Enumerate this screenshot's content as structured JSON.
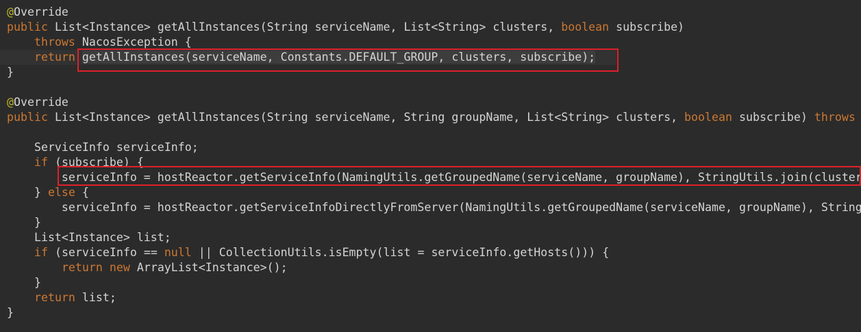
{
  "editor": {
    "lines": [
      {
        "tokens": [
          {
            "cls": "ann",
            "t": "@"
          },
          {
            "cls": "txt",
            "t": "Override"
          }
        ]
      },
      {
        "tokens": [
          {
            "cls": "kw",
            "t": "public "
          },
          {
            "cls": "txt",
            "t": "List<Instance> getAllInstances(String serviceName, List<String> clusters, "
          },
          {
            "cls": "kw",
            "t": "boolean"
          },
          {
            "cls": "txt",
            "t": " subscribe)"
          }
        ]
      },
      {
        "tokens": [
          {
            "cls": "txt",
            "t": "    "
          },
          {
            "cls": "kw",
            "t": "throws "
          },
          {
            "cls": "txt",
            "t": "NacosException {"
          }
        ]
      },
      {
        "tokens": [
          {
            "cls": "txt",
            "t": "    "
          },
          {
            "cls": "kw",
            "t": "return "
          },
          {
            "cls": "txt sel",
            "t": "getAllInstances(serviceName, Constants.DEFAULT_GROUP, clusters, subscribe);"
          }
        ]
      },
      {
        "tokens": [
          {
            "cls": "txt",
            "t": "}"
          }
        ]
      },
      {
        "tokens": [
          {
            "cls": "txt",
            "t": ""
          }
        ]
      },
      {
        "tokens": [
          {
            "cls": "ann",
            "t": "@"
          },
          {
            "cls": "txt",
            "t": "Override"
          }
        ]
      },
      {
        "tokens": [
          {
            "cls": "kw",
            "t": "public "
          },
          {
            "cls": "txt",
            "t": "List<Instance> getAllInstances(String serviceName, String groupName, List<String> clusters, "
          },
          {
            "cls": "kw",
            "t": "boolean"
          },
          {
            "cls": "txt",
            "t": " subscribe) "
          },
          {
            "cls": "kw",
            "t": "throws"
          }
        ]
      },
      {
        "tokens": [
          {
            "cls": "txt",
            "t": ""
          }
        ]
      },
      {
        "tokens": [
          {
            "cls": "txt",
            "t": "    ServiceInfo serviceInfo;"
          }
        ]
      },
      {
        "tokens": [
          {
            "cls": "txt",
            "t": "    "
          },
          {
            "cls": "kw",
            "t": "if "
          },
          {
            "cls": "txt",
            "t": "(subscribe) {"
          }
        ]
      },
      {
        "tokens": [
          {
            "cls": "txt",
            "t": "        serviceInfo = hostReactor.getServiceInfo(NamingUtils.getGroupedName(serviceName, groupName), StringUtils.join(clusters"
          }
        ]
      },
      {
        "tokens": [
          {
            "cls": "txt",
            "t": "    } "
          },
          {
            "cls": "kw",
            "t": "else "
          },
          {
            "cls": "txt",
            "t": "{"
          }
        ]
      },
      {
        "tokens": [
          {
            "cls": "txt",
            "t": "        serviceInfo = hostReactor.getServiceInfoDirectlyFromServer(NamingUtils.getGroupedName(serviceName, groupName), String"
          }
        ]
      },
      {
        "tokens": [
          {
            "cls": "txt",
            "t": "    }"
          }
        ]
      },
      {
        "tokens": [
          {
            "cls": "txt",
            "t": "    List<Instance> list;"
          }
        ]
      },
      {
        "tokens": [
          {
            "cls": "txt",
            "t": "    "
          },
          {
            "cls": "kw",
            "t": "if "
          },
          {
            "cls": "txt",
            "t": "(serviceInfo == "
          },
          {
            "cls": "kw",
            "t": "null"
          },
          {
            "cls": "txt",
            "t": " || CollectionUtils.isEmpty(list = serviceInfo.getHosts())) {"
          }
        ]
      },
      {
        "tokens": [
          {
            "cls": "txt",
            "t": "        "
          },
          {
            "cls": "kw",
            "t": "return new "
          },
          {
            "cls": "txt",
            "t": "ArrayList<Instance>();"
          }
        ]
      },
      {
        "tokens": [
          {
            "cls": "txt",
            "t": "    }"
          }
        ]
      },
      {
        "tokens": [
          {
            "cls": "txt",
            "t": "    "
          },
          {
            "cls": "kw",
            "t": "return "
          },
          {
            "cls": "txt",
            "t": "list;"
          }
        ]
      },
      {
        "tokens": [
          {
            "cls": "txt",
            "t": "}"
          }
        ]
      }
    ],
    "colors": {
      "background": "#2b2b2b",
      "keyword": "#cc7832",
      "annotation": "#bbb529",
      "text": "#d4d4d4",
      "highlight_box": "#e0202a"
    }
  }
}
